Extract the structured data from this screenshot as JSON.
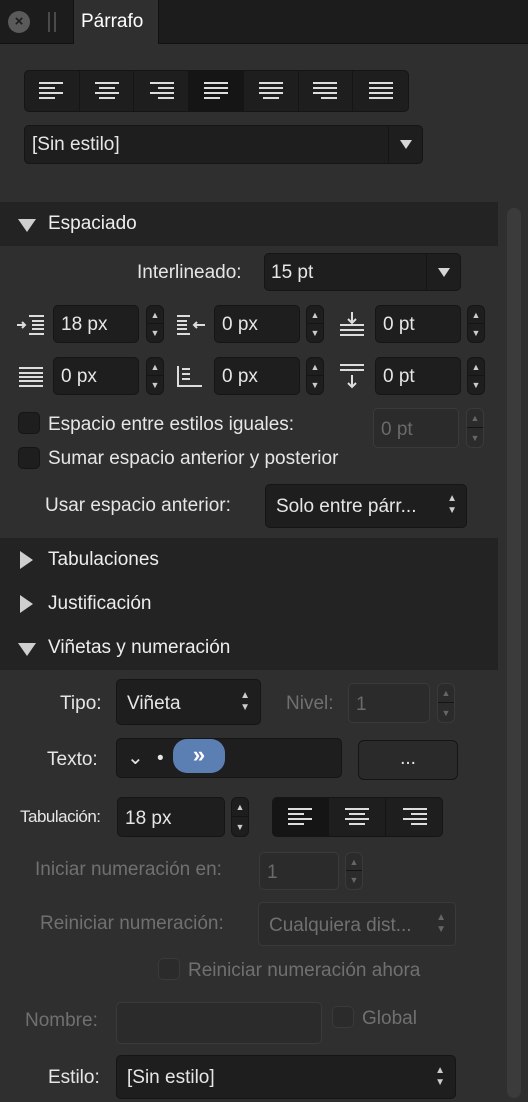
{
  "tab": {
    "title": "Párrafo"
  },
  "alignment": {
    "buttons": [
      "align-left",
      "align-center",
      "align-right",
      "justify-left",
      "justify-center",
      "justify-right",
      "justify-all"
    ],
    "selected_index": 3
  },
  "paragraph_style": {
    "value": "[Sin estilo]"
  },
  "spacing": {
    "title": "Espaciado",
    "leading_label": "Interlineado:",
    "leading_value": "15 pt",
    "left_indent": "18 px",
    "first_line_indent": "0 px",
    "space_before": "0 pt",
    "right_indent": "0 px",
    "last_line_indent": "0 px",
    "space_after": "0 pt",
    "same_styles_label": "Espacio entre estilos iguales:",
    "same_styles_value": "0 pt",
    "sum_label": "Sumar espacio anterior y posterior",
    "use_before_label": "Usar espacio anterior:",
    "use_before_value": "Solo entre párr..."
  },
  "sections": {
    "tabs": "Tabulaciones",
    "justification": "Justificación",
    "bullets": "Viñetas y numeración"
  },
  "bullets": {
    "type_label": "Tipo:",
    "type_value": "Viñeta",
    "level_label": "Nivel:",
    "level_value": "1",
    "text_label": "Texto:",
    "text_dropdown": "⌄",
    "text_bullet": "•",
    "text_pill": "»",
    "more_button": "...",
    "tab_label": "Tabulación:",
    "tab_value": "18 px",
    "start_label": "Iniciar numeración en:",
    "start_value": "1",
    "restart_label": "Reiniciar numeración:",
    "restart_value": "Cualquiera dist...",
    "restart_now_label": "Reiniciar numeración ahora",
    "name_label": "Nombre:",
    "name_value": "",
    "global_label": "Global",
    "style_label": "Estilo:",
    "style_value": "[Sin estilo]"
  },
  "colors": {
    "accent": "#5b7fb3",
    "panel": "#2f2f2f",
    "header": "#232323",
    "field": "#1e1e1e"
  }
}
